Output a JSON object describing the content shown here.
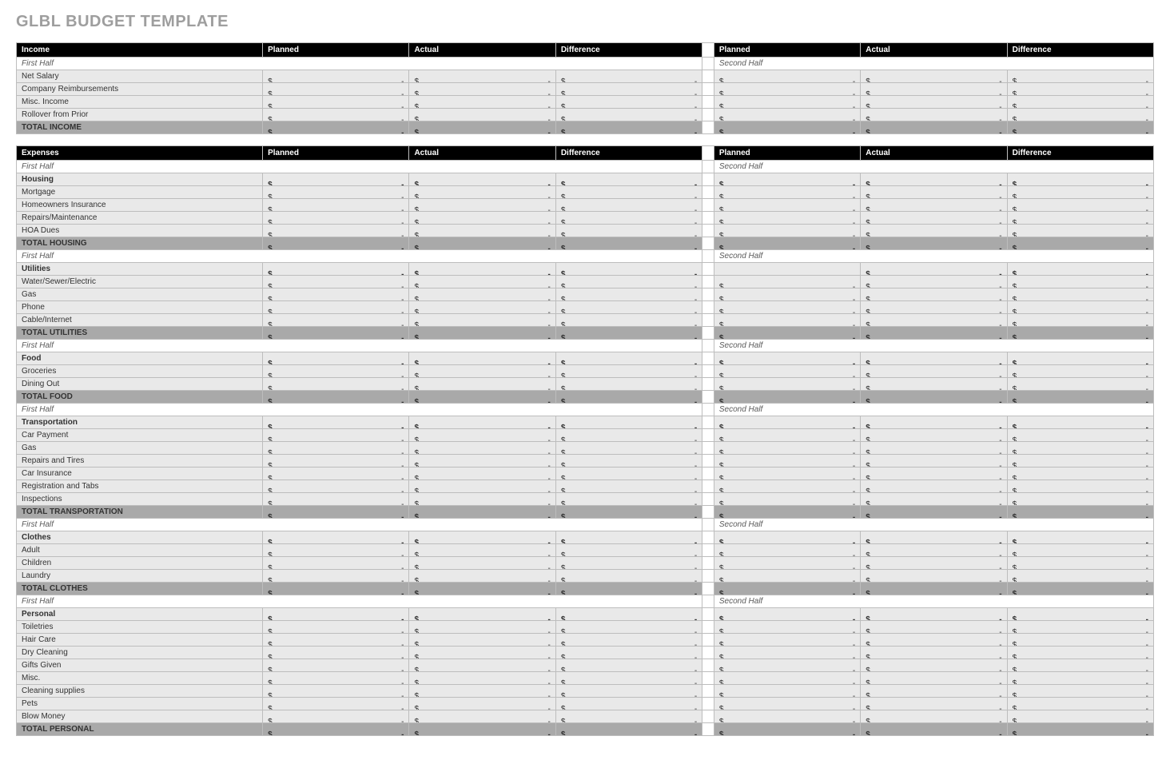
{
  "title": "GLBL BUDGET TEMPLATE",
  "columns": {
    "income": "Income",
    "expenses": "Expenses",
    "planned": "Planned",
    "actual": "Actual",
    "difference": "Difference"
  },
  "labels": {
    "first_half": "First Half",
    "second_half": "Second Half"
  },
  "income": {
    "rows": [
      "Net Salary",
      "Company Reimbursements",
      "Misc. Income",
      "Rollover from Prior"
    ],
    "total": "TOTAL INCOME"
  },
  "expenses": [
    {
      "category": "Housing",
      "rows": [
        "Mortgage",
        "Homeowners Insurance",
        "Repairs/Maintenance",
        "HOA Dues"
      ],
      "total": "TOTAL HOUSING"
    },
    {
      "category": "Utilities",
      "rows": [
        "Water/Sewer/Electric",
        "Gas",
        "Phone",
        "Cable/Internet"
      ],
      "total": "TOTAL UTILITIES",
      "secondHalfFirstCellEmpty": true
    },
    {
      "category": "Food",
      "rows": [
        "Groceries",
        "Dining Out"
      ],
      "total": "TOTAL FOOD"
    },
    {
      "category": "Transportation",
      "rows": [
        "Car Payment",
        "Gas",
        "Repairs and Tires",
        "Car Insurance",
        "Registration and Tabs",
        "Inspections"
      ],
      "total": "TOTAL TRANSPORTATION"
    },
    {
      "category": "Clothes",
      "rows": [
        "Adult",
        "Children",
        "Laundry"
      ],
      "total": "TOTAL CLOTHES"
    },
    {
      "category": "Personal",
      "rows": [
        "Toiletries",
        "Hair Care",
        "Dry Cleaning",
        "Gifts Given",
        "Misc.",
        "Cleaning supplies",
        "Pets",
        "Blow Money"
      ],
      "total": "TOTAL PERSONAL"
    }
  ]
}
